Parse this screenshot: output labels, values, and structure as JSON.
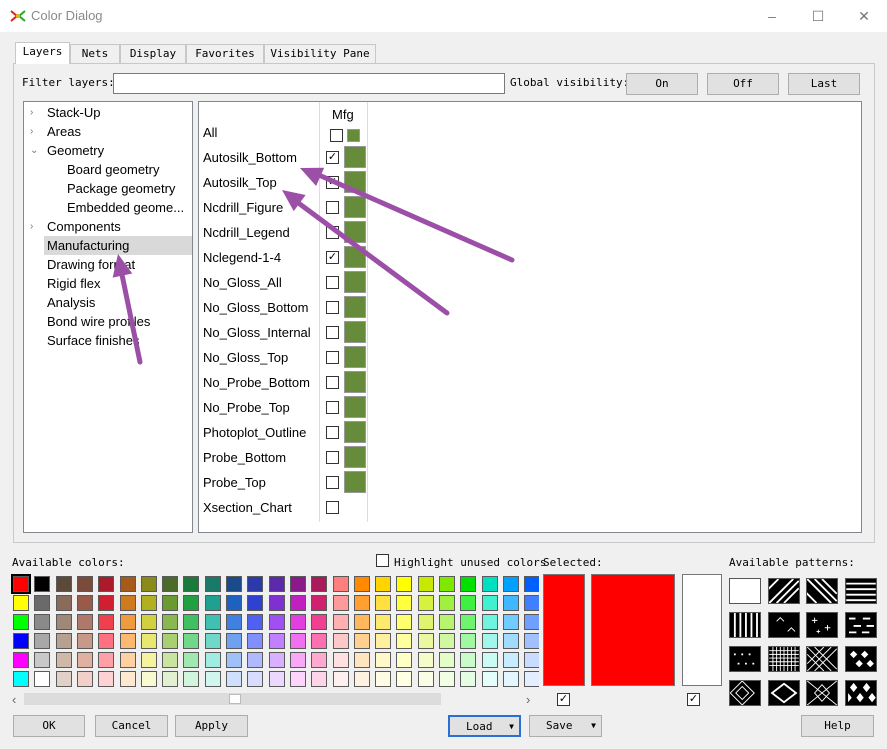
{
  "window": {
    "title": "Color Dialog",
    "minimize": "–",
    "maximize": "☐",
    "close": "✕"
  },
  "tabs": [
    "Layers",
    "Nets",
    "Display",
    "Favorites",
    "Visibility Pane"
  ],
  "filter": {
    "label": "Filter layers:",
    "value": "",
    "global_label": "Global visibility:",
    "on": "On",
    "off": "Off",
    "last": "Last"
  },
  "tree": [
    {
      "label": "Stack-Up",
      "chevron": "›",
      "indent": 0
    },
    {
      "label": "Areas",
      "chevron": "›",
      "indent": 0
    },
    {
      "label": "Geometry",
      "chevron": "⌄",
      "indent": 0
    },
    {
      "label": "Board geometry",
      "chevron": "",
      "indent": 1
    },
    {
      "label": "Package geometry",
      "chevron": "",
      "indent": 1
    },
    {
      "label": "Embedded geome...",
      "chevron": "",
      "indent": 1
    },
    {
      "label": "Components",
      "chevron": "›",
      "indent": 0
    },
    {
      "label": "Manufacturing",
      "chevron": "",
      "indent": 0,
      "selected": true
    },
    {
      "label": "Drawing format",
      "chevron": "",
      "indent": 0
    },
    {
      "label": "Rigid flex",
      "chevron": "",
      "indent": 0
    },
    {
      "label": "Analysis",
      "chevron": "",
      "indent": 0
    },
    {
      "label": "Bond wire profiles",
      "chevron": "",
      "indent": 0
    },
    {
      "label": "Surface finishes",
      "chevron": "",
      "indent": 0
    }
  ],
  "grid": {
    "column": "Mfg",
    "all_label": "All",
    "layers": [
      {
        "name": "Autosilk_Bottom",
        "checked": true,
        "swatch": true
      },
      {
        "name": "Autosilk_Top",
        "checked": true,
        "swatch": true
      },
      {
        "name": "Ncdrill_Figure",
        "checked": false,
        "swatch": true
      },
      {
        "name": "Ncdrill_Legend",
        "checked": false,
        "swatch": true
      },
      {
        "name": "Nclegend-1-4",
        "checked": true,
        "swatch": true
      },
      {
        "name": "No_Gloss_All",
        "checked": false,
        "swatch": true
      },
      {
        "name": "No_Gloss_Bottom",
        "checked": false,
        "swatch": true
      },
      {
        "name": "No_Gloss_Internal",
        "checked": false,
        "swatch": true
      },
      {
        "name": "No_Gloss_Top",
        "checked": false,
        "swatch": true
      },
      {
        "name": "No_Probe_Bottom",
        "checked": false,
        "swatch": true
      },
      {
        "name": "No_Probe_Top",
        "checked": false,
        "swatch": true
      },
      {
        "name": "Photoplot_Outline",
        "checked": false,
        "swatch": true
      },
      {
        "name": "Probe_Bottom",
        "checked": false,
        "swatch": true
      },
      {
        "name": "Probe_Top",
        "checked": false,
        "swatch": true
      },
      {
        "name": "Xsection_Chart",
        "checked": false,
        "swatch": false
      }
    ]
  },
  "colors": {
    "layer_green": "#668b3b",
    "selected_red": "#ff0000",
    "annotation_purple": "#9b4fa6",
    "palette_rows": [
      [
        "#ff0000",
        "#000000",
        "#5b4a3a",
        "#7a4a3a",
        "#aa1a2a",
        "#a65a1a",
        "#8a8a1a",
        "#4a6a2a",
        "#1a7a3a",
        "#1a7a6a",
        "#1a4a8a",
        "#2a3aaa",
        "#5a2aaa",
        "#8a1a8a",
        "#aa1a5a",
        "#ff7f7f",
        "#ff8a00",
        "#ffd400",
        "#ffff00",
        "#c8e800",
        "#80e800",
        "#00e000",
        "#00e0c0",
        "#00a0ff",
        "#0060ff"
      ],
      [
        "#ffff00",
        "#6a6a6a",
        "#8a6a5a",
        "#9a5a4a",
        "#d02030",
        "#d07a20",
        "#b0b020",
        "#6a9a30",
        "#20a040",
        "#20a090",
        "#2060c0",
        "#3040d0",
        "#8030d0",
        "#c020c0",
        "#d02070",
        "#ff9a9a",
        "#ffa030",
        "#ffe040",
        "#ffff40",
        "#d8f040",
        "#a0f040",
        "#40f040",
        "#40f0d0",
        "#40b8ff",
        "#4080ff"
      ],
      [
        "#00ff00",
        "#8a8a8a",
        "#a08878",
        "#b07868",
        "#f04050",
        "#f09a40",
        "#d0d040",
        "#8ab850",
        "#40c060",
        "#40c0b0",
        "#4080e0",
        "#5060f0",
        "#a050f0",
        "#e040e0",
        "#f04090",
        "#ffb0b0",
        "#ffb860",
        "#ffe870",
        "#ffff70",
        "#e0f470",
        "#b8f470",
        "#70f470",
        "#70f4e0",
        "#70ccff",
        "#70a0ff"
      ],
      [
        "#0000ff",
        "#a8a8a8",
        "#b8a090",
        "#c89888",
        "#ff7080",
        "#ffb870",
        "#e8e870",
        "#a8d070",
        "#70d888",
        "#70d8c8",
        "#70a0f0",
        "#8090ff",
        "#c080ff",
        "#f070f0",
        "#ff70b0",
        "#ffc8c8",
        "#ffd090",
        "#fff0a0",
        "#ffffa0",
        "#ecf8a0",
        "#d0f8a0",
        "#a0f8a0",
        "#a0f8ec",
        "#a0dcff",
        "#a0c0ff"
      ],
      [
        "#ff00ff",
        "#c8c8c8",
        "#d0b8a8",
        "#e0b0a0",
        "#ffa0a8",
        "#ffd0a0",
        "#f4f4a0",
        "#c8e4a0",
        "#a0e8b0",
        "#a0ece0",
        "#a0c0f8",
        "#b0b8ff",
        "#d8b0ff",
        "#f8a8f8",
        "#ffa8d0",
        "#ffe0e0",
        "#ffe4c0",
        "#fff8c8",
        "#ffffc8",
        "#f4fcc8",
        "#e4fcc8",
        "#c8fcc8",
        "#c8fcf4",
        "#c8ecff",
        "#c8dcff"
      ],
      [
        "#00ffff",
        "#ffffff",
        "#e0d0c8",
        "#f0d0c8",
        "#ffd0d4",
        "#ffe8d0",
        "#fafad0",
        "#e0f0d0",
        "#d0f4dc",
        "#d0f6f0",
        "#d0e0fc",
        "#d8dcff",
        "#ecd8ff",
        "#fcd4fc",
        "#ffd4e8",
        "#fff0f0",
        "#fff2e0",
        "#fffce4",
        "#ffffe4",
        "#fafee4",
        "#f2fee4",
        "#e4fee4",
        "#e4fefa",
        "#e4f6ff",
        "#e4eeff"
      ]
    ]
  },
  "palette": {
    "available_label": "Available colors:",
    "highlight_label": "Highlight unused colors",
    "selected_label": "Selected:",
    "patterns_label": "Available patterns:",
    "scroll_left": "‹",
    "scroll_right": "›"
  },
  "patterns": [
    "solid-white",
    "diag-right",
    "diag-left",
    "horizontal",
    "vertical",
    "dots-arrows",
    "plus",
    "dashes",
    "dots-fine",
    "grid-fine",
    "crosshatch",
    "diamond-dots",
    "diamond-fine",
    "diamond",
    "x-diamond",
    "checker-diamond"
  ],
  "footer": {
    "ok": "OK",
    "cancel": "Cancel",
    "apply": "Apply",
    "load": "Load",
    "save": "Save",
    "help": "Help",
    "dropdown": "▼"
  }
}
